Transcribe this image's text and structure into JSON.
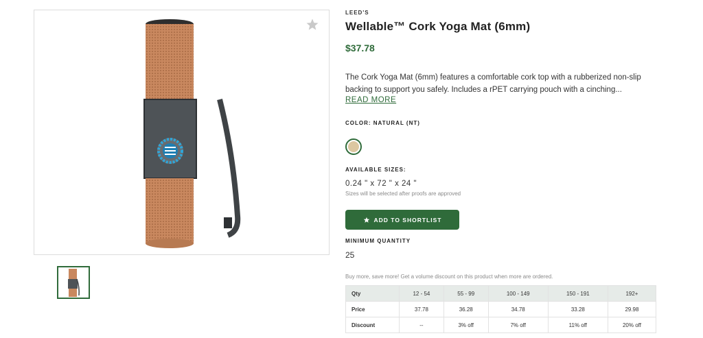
{
  "gallery": {
    "favorite_icon": "star-icon",
    "product_image": "cork-yoga-mat-with-carry-pouch"
  },
  "product": {
    "brand": "LEED'S",
    "title": "Wellable™ Cork Yoga Mat (6mm)",
    "price": "$37.78",
    "description": "The Cork Yoga Mat (6mm) features a comfortable cork top with a rubberized non-slip backing to support you safely. Includes a rPET carrying pouch with a cinching...",
    "read_more": "READ MORE"
  },
  "color": {
    "label": "COLOR: NATURAL (NT)",
    "swatch_hex": "#dcc7a1"
  },
  "sizes": {
    "label": "AVAILABLE SIZES:",
    "value": "0.24 \" x 72 \" x 24 \"",
    "note": "Sizes will be selected after proofs are approved"
  },
  "actions": {
    "shortlist_label": "ADD TO SHORTLIST",
    "shortlist_icon": "star-icon"
  },
  "minimum": {
    "label": "MINIMUM QUANTITY",
    "value": "25"
  },
  "volume": {
    "note": "Buy more, save more! Get a volume discount on this product when more are ordered.",
    "header": [
      "Qty",
      "12 - 54",
      "55 - 99",
      "100 - 149",
      "150 - 191",
      "192+"
    ],
    "rows": [
      [
        "Price",
        "37.78",
        "36.28",
        "34.78",
        "33.28",
        "29.98"
      ],
      [
        "Discount",
        "--",
        "3% off",
        "7% off",
        "11% off",
        "20% off"
      ]
    ]
  },
  "colors": {
    "accent": "#2f6b3a",
    "table_header_bg": "#e6ebe8"
  }
}
